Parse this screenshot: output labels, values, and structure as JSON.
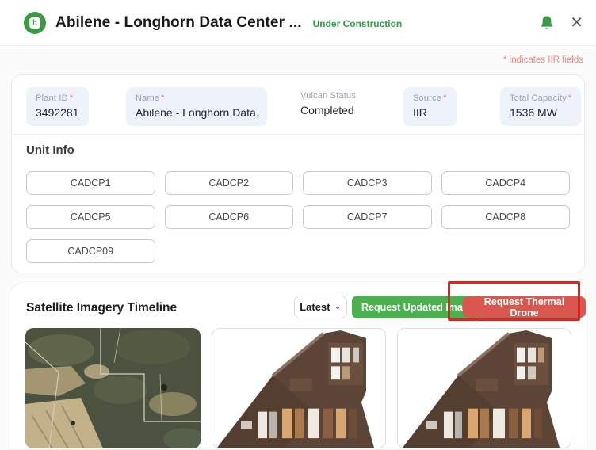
{
  "header": {
    "title": "Abilene - Longhorn Data Center ...",
    "status_badge": "Under Construction",
    "logo_glyph": "h"
  },
  "note": "* indicates IIR fields",
  "details": {
    "fields": [
      {
        "label": "Plant ID",
        "star": "*",
        "value": "3492281"
      },
      {
        "label": "Name",
        "star": "*",
        "value": "Abilene - Longhorn Data..."
      },
      {
        "label": "Vulcan Status",
        "value": "Completed"
      },
      {
        "label": "Source",
        "star": "*",
        "value": "IIR"
      },
      {
        "label": "Total Capacity",
        "star": "*",
        "value": "1536 MW"
      }
    ]
  },
  "unit_info": {
    "title": "Unit Info",
    "units": [
      "CADCP1",
      "CADCP2",
      "CADCP3",
      "CADCP4",
      "CADCP5",
      "CADCP6",
      "CADCP7",
      "CADCP8",
      "CADCP09"
    ]
  },
  "timeline": {
    "title": "Satellite Imagery Timeline",
    "filter_value": "Latest",
    "request_updated_label": "Request Updated Image",
    "request_thermal_label": "Request Thermal Drone"
  },
  "icons": [
    "logo-icon",
    "bell-icon",
    "close-icon",
    "chevron-down-icon"
  ],
  "colors": {
    "brand_green": "#3d9a44",
    "status_green": "#2e9e44",
    "button_green": "#4caf50",
    "button_red": "#d9574e",
    "annotation_red": "#e9211d",
    "field_bg": "#eef2fb",
    "note_red": "#f2837b",
    "label_gray": "#9aa1ad"
  }
}
